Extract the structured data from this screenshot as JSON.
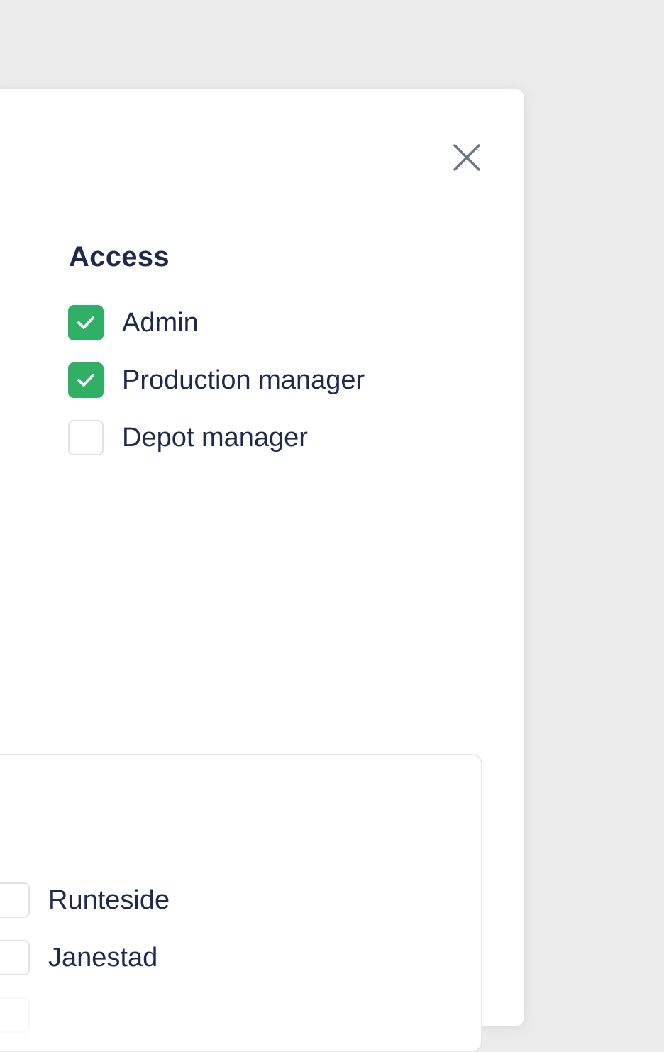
{
  "modal": {
    "close_icon": "close-icon",
    "access": {
      "title": "Access",
      "options": [
        {
          "label": "Admin",
          "checked": true
        },
        {
          "label": "Production manager",
          "checked": true
        },
        {
          "label": "Depot manager",
          "checked": false
        }
      ]
    },
    "locations": {
      "options": [
        {
          "label": "Runteside",
          "checked": false
        },
        {
          "label": "Janestad",
          "checked": false
        }
      ]
    }
  },
  "colors": {
    "checked": "#2fb064",
    "text": "#1e2a4a",
    "border": "#dfe3e8",
    "backdrop": "#ebebeb"
  }
}
